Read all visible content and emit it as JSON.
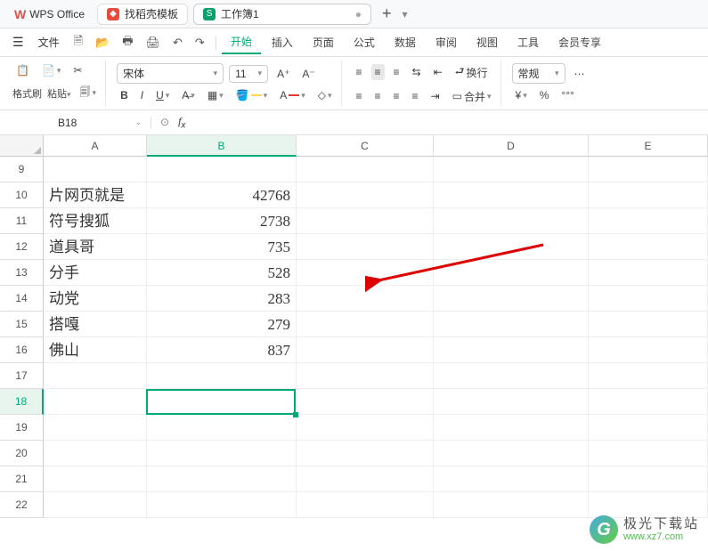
{
  "app": {
    "name": "WPS Office"
  },
  "tabs": [
    {
      "label": "找稻壳模板",
      "iconColor": "#e94a3a",
      "iconText": "D"
    },
    {
      "label": "工作簿1",
      "iconColor": "#0aa06e",
      "iconText": "S",
      "active": true
    }
  ],
  "menubar": {
    "file": "文件",
    "items": [
      "开始",
      "插入",
      "页面",
      "公式",
      "数据",
      "审阅",
      "视图",
      "工具",
      "会员专享"
    ],
    "activeIndex": 0
  },
  "toolbar": {
    "formatPainter": "格式刷",
    "paste": "粘贴",
    "fontName": "宋体",
    "fontSize": "11",
    "wrap": "换行",
    "merge": "合并",
    "numFmt": "常规"
  },
  "namebox": "B18",
  "formula": "",
  "columns": [
    "A",
    "B",
    "C",
    "D",
    "E"
  ],
  "rowNumbers": [
    9,
    10,
    11,
    12,
    13,
    14,
    15,
    16,
    17,
    18,
    19,
    20,
    21,
    22
  ],
  "activeCol": "B",
  "activeRow": 18,
  "chart_data": {
    "type": "table",
    "title": "",
    "columns": [
      "A",
      "B"
    ],
    "rows": [
      {
        "row": 10,
        "A": "片网页就是",
        "B": 42768
      },
      {
        "row": 11,
        "A": "符号搜狐",
        "B": 2738
      },
      {
        "row": 12,
        "A": "道具哥",
        "B": 735
      },
      {
        "row": 13,
        "A": "分手",
        "B": 528
      },
      {
        "row": 14,
        "A": "动党",
        "B": 283
      },
      {
        "row": 15,
        "A": "搭嘎",
        "B": 279
      },
      {
        "row": 16,
        "A": "佛山",
        "B": 837
      }
    ]
  },
  "watermark": {
    "cn": "极光下载站",
    "url": "www.xz7.com"
  }
}
